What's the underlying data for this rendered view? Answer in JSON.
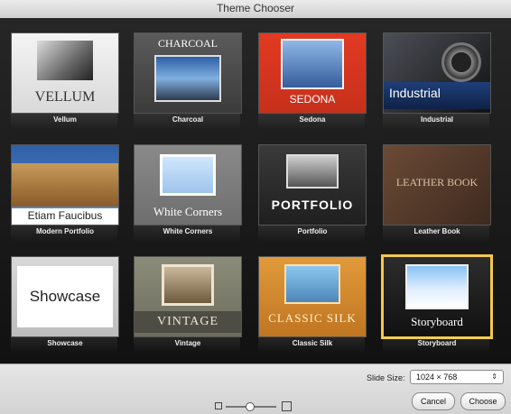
{
  "window": {
    "title": "Theme Chooser"
  },
  "themes": [
    {
      "label": "Vellum",
      "title": "VELLUM"
    },
    {
      "label": "Charcoal",
      "title": "CHARCOAL"
    },
    {
      "label": "Sedona",
      "title": "SEDONA"
    },
    {
      "label": "Industrial",
      "title": "Industrial"
    },
    {
      "label": "Modern Portfolio",
      "title": "Etiam Faucibus"
    },
    {
      "label": "White Corners",
      "title": "White Corners"
    },
    {
      "label": "Portfolio",
      "title": "PORTFOLIO"
    },
    {
      "label": "Leather Book",
      "title": "LEATHER BOOK"
    },
    {
      "label": "Showcase",
      "title": "Showcase"
    },
    {
      "label": "Vintage",
      "title": "VINTAGE"
    },
    {
      "label": "Classic Silk",
      "title": "CLASSIC SILK"
    },
    {
      "label": "Storyboard",
      "title": "Storyboard"
    }
  ],
  "footer": {
    "slide_size_label": "Slide Size:",
    "slide_size_value": "1024 × 768",
    "cancel_label": "Cancel",
    "choose_label": "Choose"
  },
  "colors": {
    "selection": "#f2c94c"
  }
}
